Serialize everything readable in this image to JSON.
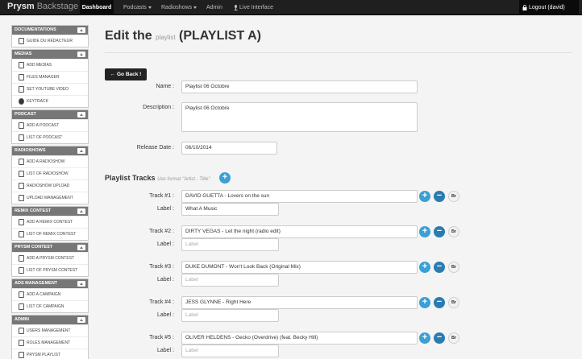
{
  "navbar": {
    "brand_bold": "Prysm",
    "brand_light": "Backstage",
    "items": [
      {
        "label": "Dashboard"
      },
      {
        "label": "Podcasts"
      },
      {
        "label": "Radioshows"
      },
      {
        "label": "Admin"
      },
      {
        "label": "Live Interface"
      }
    ],
    "logout": "Logout (david)"
  },
  "sidebar": {
    "sections": [
      {
        "title": "DOCUMENTATIONS",
        "items": [
          "GUIDE DU RÉDACTEUR"
        ]
      },
      {
        "title": "MEDIAS",
        "items": [
          "ADD MEDIAS",
          "FILES MANAGER",
          "SET YOUTUBE VIDEO",
          "KEYTRACK"
        ]
      },
      {
        "title": "PODCAST",
        "items": [
          "ADD A PODCAST",
          "LIST OF PODCAST"
        ]
      },
      {
        "title": "RADIOSHOWS",
        "items": [
          "ADD A RADIOSHOW",
          "LIST OF RADIOSHOW",
          "RADIOSHOW UPLOAD",
          "UPLOAD MANAGEMENT"
        ]
      },
      {
        "title": "REMIX CONTEST",
        "items": [
          "ADD A REMIX CONTEST",
          "LIST OF REMIX CONTEST"
        ]
      },
      {
        "title": "PRYSM CONTEST",
        "items": [
          "ADD A PRYSM CONTEST",
          "LIST OF PRYSM CONTEST"
        ]
      },
      {
        "title": "ADS MANAGEMENT",
        "items": [
          "ADD A CAMPAIGN",
          "LIST OF CAMPAIGN"
        ]
      },
      {
        "title": "ADMIN",
        "items": [
          "USERS MANAGEMENT",
          "ROLES MANAGEMENT",
          "PRYSM PLAYLIST"
        ]
      }
    ]
  },
  "page": {
    "title_prefix": "Edit the",
    "title_small": "playlist",
    "title_suffix": "(PLAYLIST A)",
    "back_button": "Go Back !"
  },
  "form": {
    "name_label": "Name :",
    "name_value": "Playlist 06 Octobre",
    "description_label": "Description :",
    "description_value": "Playlist 06 Octobre",
    "release_label": "Release Date :",
    "release_value": "06/10/2014"
  },
  "tracks": {
    "title": "Playlist Tracks",
    "hint": "Use format \"Artist - Title\"",
    "label_text": "Label :",
    "label_placeholder": "Label",
    "br_label": "Br",
    "items": [
      {
        "track_label": "Track #1 :",
        "value": "DAVID GUETTA - Lovers on the sun",
        "label_value": "What A Music"
      },
      {
        "track_label": "Track #2 :",
        "value": "DIRTY VEGAS - Let the night (radio edit)",
        "label_value": ""
      },
      {
        "track_label": "Track #3 :",
        "value": "DUKE DUMONT - Won't Look Back (Original Mix)",
        "label_value": ""
      },
      {
        "track_label": "Track #4 :",
        "value": "JESS GLYNNE - Right Here",
        "label_value": ""
      },
      {
        "track_label": "Track #5 :",
        "value": "OLIVER HELDENS - Gecko (Overdrive) (feat. Becky Hill)",
        "label_value": ""
      }
    ]
  }
}
